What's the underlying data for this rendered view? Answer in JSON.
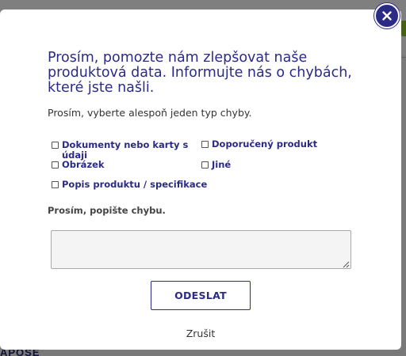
{
  "modal": {
    "title": "Prosím, pomozte nám zlepšovat naše produktová data. Informujte nás o chybách, které jste našli.",
    "subtitle": "Prosím, vyberte alespoň jeden typ chyby.",
    "error_types": [
      {
        "label": "Dokumenty nebo karty s údaji",
        "checked": false
      },
      {
        "label": "Doporučený produkt",
        "checked": false
      },
      {
        "label": "Obrázek",
        "checked": false
      },
      {
        "label": "Jiné",
        "checked": false
      },
      {
        "label": "Popis produktu / specifikace",
        "checked": false
      }
    ],
    "description_label": "Prosím, popište chybu.",
    "description_value": "",
    "submit_label": "ODESLAT",
    "cancel_label": "Zrušit",
    "close_icon": "close-icon"
  },
  "background": {
    "logo_text": "APOSE"
  },
  "colors": {
    "accent": "#2b2b86",
    "text": "#333333",
    "overlay": "rgba(0,0,0,0.5)"
  }
}
